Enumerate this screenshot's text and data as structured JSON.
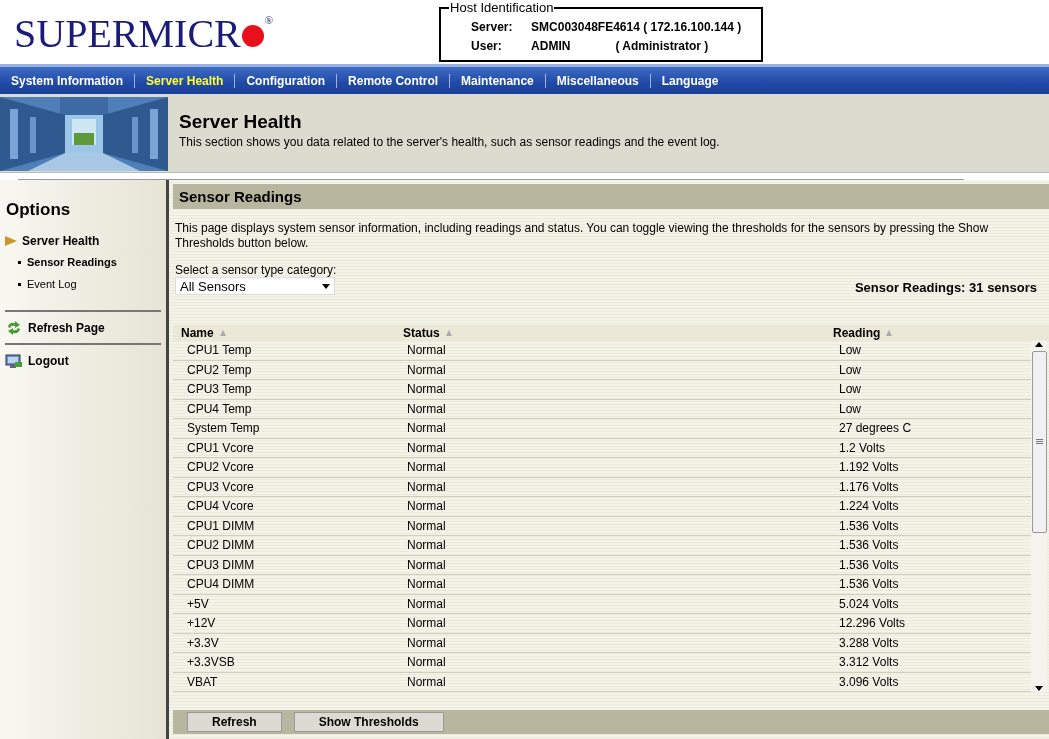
{
  "logo": {
    "text": "SUPERMICR",
    "registered": "®"
  },
  "host": {
    "legend": "Host Identification",
    "server_label": "Server:",
    "server": "SMC003048FE4614 ( 172.16.100.144 )",
    "user_label": "User:",
    "user": "ADMIN",
    "role": "( Administrator )"
  },
  "nav": [
    {
      "label": "System Information",
      "selected": false
    },
    {
      "label": "Server Health",
      "selected": true
    },
    {
      "label": "Configuration",
      "selected": false
    },
    {
      "label": "Remote Control",
      "selected": false
    },
    {
      "label": "Maintenance",
      "selected": false
    },
    {
      "label": "Miscellaneous",
      "selected": false
    },
    {
      "label": "Language",
      "selected": false
    }
  ],
  "banner": {
    "kind": "picture",
    "title": "Server Health",
    "description": "This section shows you data related to the server's health, such as sensor readings and the event log."
  },
  "sidebar": {
    "title": "Options",
    "section": "Server Health",
    "items": [
      {
        "label": "Sensor Readings",
        "selected": true
      },
      {
        "label": "Event Log",
        "selected": false
      }
    ],
    "actions": [
      {
        "label": "Refresh Page",
        "kind": "refresh"
      },
      {
        "label": "Logout",
        "kind": "logout"
      }
    ]
  },
  "main": {
    "title": "Sensor Readings",
    "description": "This page displays system sensor information, including readings and status. You can toggle viewing the thresholds for the sensors by pressing the Show Thresholds button below.",
    "select_label": "Select a sensor type category:",
    "select_value": "All Sensors",
    "count": "Sensor Readings: 31 sensors"
  },
  "table": {
    "columns": [
      "Name",
      "Status",
      "Reading"
    ],
    "rows": [
      [
        "CPU1 Temp",
        "Normal",
        "Low"
      ],
      [
        "CPU2 Temp",
        "Normal",
        "Low"
      ],
      [
        "CPU3 Temp",
        "Normal",
        "Low"
      ],
      [
        "CPU4 Temp",
        "Normal",
        "Low"
      ],
      [
        "System Temp",
        "Normal",
        "27 degrees C"
      ],
      [
        "CPU1 Vcore",
        "Normal",
        "1.2 Volts"
      ],
      [
        "CPU2 Vcore",
        "Normal",
        "1.192 Volts"
      ],
      [
        "CPU3 Vcore",
        "Normal",
        "1.176 Volts"
      ],
      [
        "CPU4 Vcore",
        "Normal",
        "1.224 Volts"
      ],
      [
        "CPU1 DIMM",
        "Normal",
        "1.536 Volts"
      ],
      [
        "CPU2 DIMM",
        "Normal",
        "1.536 Volts"
      ],
      [
        "CPU3 DIMM",
        "Normal",
        "1.536 Volts"
      ],
      [
        "CPU4 DIMM",
        "Normal",
        "1.536 Volts"
      ],
      [
        "+5V",
        "Normal",
        "5.024 Volts"
      ],
      [
        "+12V",
        "Normal",
        "12.296 Volts"
      ],
      [
        "+3.3V",
        "Normal",
        "3.288 Volts"
      ],
      [
        "+3.3VSB",
        "Normal",
        "3.312 Volts"
      ],
      [
        "VBAT",
        "Normal",
        "3.096 Volts"
      ]
    ]
  },
  "buttons": [
    "Refresh",
    "Show Thresholds"
  ]
}
